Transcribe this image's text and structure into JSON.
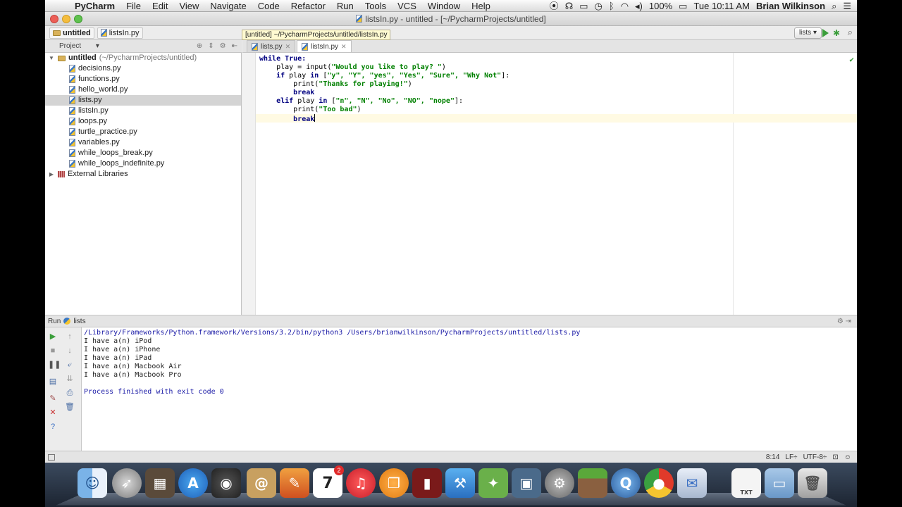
{
  "menubar": {
    "app": "PyCharm",
    "items": [
      "File",
      "Edit",
      "View",
      "Navigate",
      "Code",
      "Refactor",
      "Run",
      "Tools",
      "VCS",
      "Window",
      "Help"
    ],
    "battery": "100%",
    "clock": "Tue 10:11 AM",
    "user": "Brian Wilkinson"
  },
  "window": {
    "title": "listsIn.py - untitled - [~/PycharmProjects/untitled]"
  },
  "navbar": {
    "crumb_project": "untitled",
    "crumb_file": "listsIn.py",
    "tooltip": "[untitled] ~/PycharmProjects/untitled/listsIn.py",
    "run_config": "lists"
  },
  "project": {
    "panel_label": "Project",
    "root_name": "untitled",
    "root_path": "(~/PycharmProjects/untitled)",
    "files": [
      "decisions.py",
      "functions.py",
      "hello_world.py",
      "lists.py",
      "listsIn.py",
      "loops.py",
      "turtle_practice.py",
      "variables.py",
      "while_loops_break.py",
      "while_loops_indefinite.py"
    ],
    "selected_index": 3,
    "external": "External Libraries"
  },
  "tabs": [
    {
      "label": "lists.py"
    },
    {
      "label": "listsIn.py"
    }
  ],
  "code": {
    "l1_kw": "while True:",
    "l2_a": "    play = input(",
    "l2_s": "\"Would you like to play? \"",
    "l2_b": ")",
    "l3_kw1": "    if",
    "l3_a": " play ",
    "l3_kw2": "in",
    "l3_b": " [",
    "l3_s": "\"y\", \"Y\", \"yes\", \"Yes\", \"Sure\", \"Why Not\"",
    "l3_c": "]:",
    "l4_a": "        print(",
    "l4_s": "\"Thanks for playing!\"",
    "l4_b": ")",
    "l5_kw": "        break",
    "l6_kw1": "    elif",
    "l6_a": " play ",
    "l6_kw2": "in",
    "l6_b": " [",
    "l6_s": "\"n\", \"N\", \"No\", \"NO\", \"nope\"",
    "l6_c": "]:",
    "l7_a": "        print(",
    "l7_s": "\"Too bad\"",
    "l7_b": ")",
    "l8_kw": "        break"
  },
  "run": {
    "label": "Run",
    "config": "lists",
    "command": "/Library/Frameworks/Python.framework/Versions/3.2/bin/python3 /Users/brianwilkinson/PycharmProjects/untitled/lists.py",
    "output": [
      "I have a(n) iPod",
      "I have a(n) iPhone",
      "I have a(n) iPad",
      "I have a(n) Macbook Air",
      "I have a(n) Macbook Pro"
    ],
    "finished": "Process finished with exit code 0"
  },
  "status": {
    "position": "8:14",
    "line_sep": "LF÷",
    "encoding": "UTF-8÷"
  },
  "dock": {
    "calendar_day": "7",
    "calendar_badge": "2",
    "text_label": "TXT"
  },
  "colors": {
    "accent_green": "#3b9e3b",
    "keyword": "#000080",
    "string": "#008000"
  }
}
